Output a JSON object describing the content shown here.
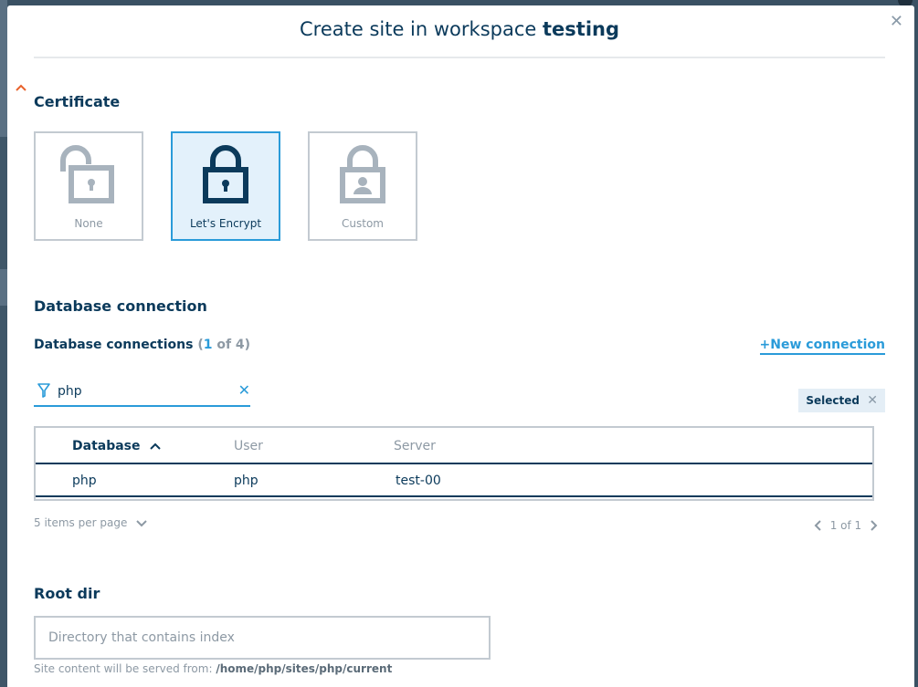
{
  "modal": {
    "title_prefix": "Create site in workspace",
    "title_workspace": "testing"
  },
  "certificate": {
    "heading": "Certificate",
    "options": [
      {
        "label": "None",
        "icon": "unlocked-padlock-icon",
        "selected": false
      },
      {
        "label": "Let's Encrypt",
        "icon": "locked-padlock-icon",
        "selected": true
      },
      {
        "label": "Custom",
        "icon": "user-padlock-icon",
        "selected": false
      }
    ]
  },
  "database": {
    "heading": "Database connection",
    "connections_label": "Database connections",
    "count_open": "(",
    "count_selected": "1",
    "count_of": " of 4)",
    "new_connection": "+New connection",
    "filter_value": "php",
    "selected_chip": "Selected",
    "columns": [
      "Database",
      "User",
      "Server"
    ],
    "rows": [
      {
        "database": "php",
        "user": "php",
        "server": "test-00"
      }
    ],
    "per_page": "5 items per page",
    "pagination": "1 of 1"
  },
  "root_dir": {
    "heading": "Root dir",
    "placeholder": "Directory that contains index",
    "hint_prefix": "Site content will be served from: ",
    "hint_path": "/home/php/sites/php/current"
  },
  "colors": {
    "accent": "#2a9bd9",
    "text_dark": "#0b3a5b",
    "muted": "#8d99a4",
    "border": "#c3cad1",
    "collapse_chevron": "#e8622c"
  }
}
